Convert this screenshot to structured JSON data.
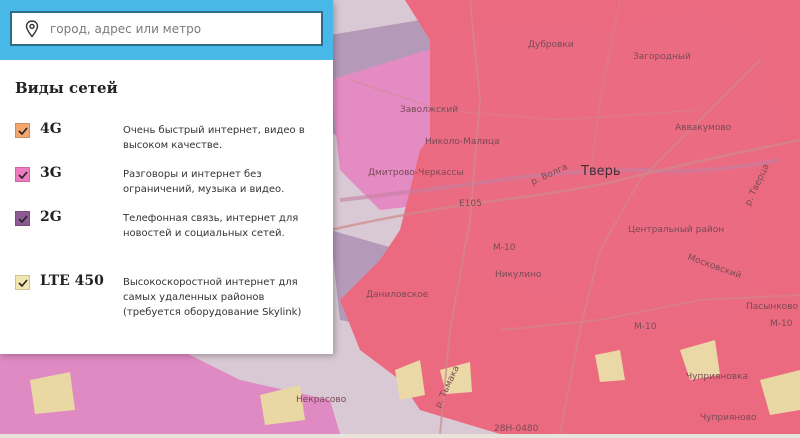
{
  "search": {
    "placeholder": "город, адрес или метро"
  },
  "panel": {
    "title": "Виды сетей",
    "networks": [
      {
        "name": "4G",
        "description": "Очень быстрый интернет, видео в высоком качестве.",
        "color": "#f3a66d",
        "checked": true
      },
      {
        "name": "3G",
        "description": "Разговоры и интернет без ограничений, музыка и видео.",
        "color": "#ee7ac0",
        "checked": true
      },
      {
        "name": "2G",
        "description": "Телефонная связь, интернет для новостей и социальных сетей.",
        "color": "#8e5a92",
        "checked": true
      },
      {
        "name": "LTE 450",
        "description": "Высокоскоростной интернет для самых удаленных районов (требуется оборудование Skylink)",
        "color": "#f2e6b0",
        "checked": true
      }
    ]
  },
  "map": {
    "colors": {
      "coverage_4g": "#ee6a7e",
      "coverage_3g": "#e48ac0",
      "coverage_2g": "#b19ab4",
      "lte450": "#e8d9a6",
      "base": "#e2dcd2"
    },
    "labels": {
      "city": "Тверь",
      "dubrovki": "Дубровки",
      "zagorodny": "Загородный",
      "zavolzhsky": "Заволжский",
      "nikolo_malitsa": "Николо-Малица",
      "aavakumovo": "Аввакумово",
      "dmitrovo_cherkassy": "Дмитрово-Черкассы",
      "r_volga": "р. Волга",
      "center_district": "Центральный район",
      "nikulino": "Никулино",
      "danilovskoe": "Даниловское",
      "moskovsky": "Московский",
      "m10": "М-10",
      "m10b": "М-10",
      "pasynkovo": "Пасынково",
      "chuprianovka": "Чуприяновка",
      "chuprianovo": "Чуприяново",
      "nekrasovo": "Некрасово",
      "r_tmaka": "р. Тьмака",
      "r_tvertsa": "р. Тверца",
      "e105": "Е105",
      "m10c": "М-10",
      "road_number": "28Н-0480"
    }
  }
}
